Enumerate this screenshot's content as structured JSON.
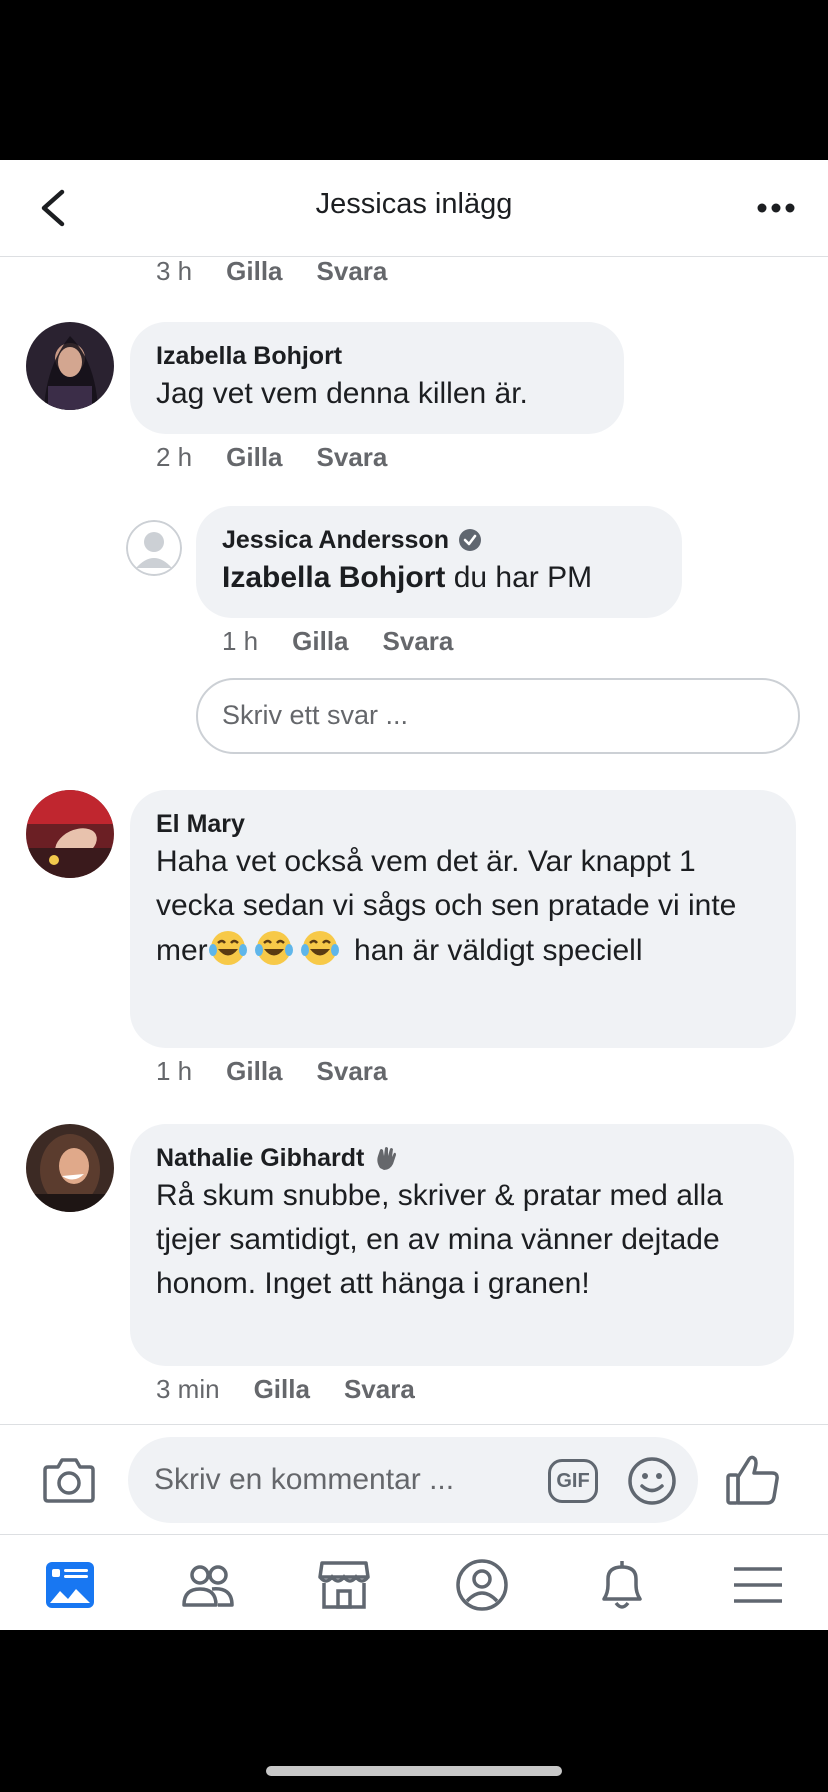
{
  "header": {
    "title": "Jessicas inlägg",
    "back_icon": "chevron-left-icon",
    "more_icon": "more-dots-icon"
  },
  "comments": {
    "prev": {
      "time": "3 h",
      "like": "Gilla",
      "reply": "Svara"
    },
    "c1": {
      "name": "Izabella Bohjort",
      "text": "Jag vet vem denna killen är.",
      "time": "2 h",
      "like": "Gilla",
      "reply": "Svara"
    },
    "r1": {
      "name": "Jessica Andersson",
      "badge_icon": "verified-badge-icon",
      "mention": "Izabella Bohjort",
      "text": " du har PM",
      "time": "1 h",
      "like": "Gilla",
      "reply": "Svara"
    },
    "reply_placeholder": "Skriv ett svar ...",
    "c2": {
      "name": "El Mary",
      "text_before": "Haha vet också vem det är. Var knappt 1 vecka sedan vi sågs och sen pratade vi inte mer",
      "text_after": " han är väldigt speciell",
      "emoji_icon": "laughing-tears-emoji-icon",
      "time": "1 h",
      "like": "Gilla",
      "reply": "Svara"
    },
    "c3": {
      "name": "Nathalie Gibhardt",
      "badge_icon": "waving-hand-icon",
      "text": "Rå skum snubbe, skriver & pratar med alla tjejer samtidigt, en av mina vänner dejtade honom. Inget att hänga i granen!",
      "time": "3 min",
      "like": "Gilla",
      "reply": "Svara"
    }
  },
  "composer": {
    "placeholder": "Skriv en kommentar ...",
    "gif_label": "GIF"
  },
  "tabs": [
    "news-feed-icon",
    "friends-icon",
    "marketplace-icon",
    "profile-icon",
    "notifications-icon",
    "menu-icon"
  ],
  "colors": {
    "accent": "#1877f2",
    "bubble": "#f0f2f5",
    "meta": "#65676b"
  }
}
